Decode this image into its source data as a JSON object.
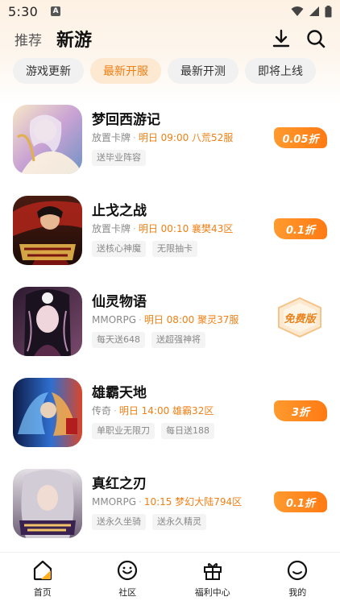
{
  "status_bar": {
    "time": "5:30",
    "notification_letter": "A"
  },
  "header": {
    "tab_recommend": "推荐",
    "tab_new_games": "新游",
    "download_icon": "download-icon",
    "search_icon": "search-icon"
  },
  "filters": [
    {
      "label": "游戏更新",
      "active": false
    },
    {
      "label": "最新开服",
      "active": true
    },
    {
      "label": "最新开测",
      "active": false
    },
    {
      "label": "即将上线",
      "active": false
    }
  ],
  "games": [
    {
      "title": "梦回西游记",
      "type": "放置卡牌",
      "open_info": "明日 09:00 八荒52服",
      "tags": [
        "送毕业阵容"
      ],
      "badge": "0.05折",
      "badge_kind": "discount",
      "cover_colors": [
        "#f3e0c0",
        "#c8a3d8",
        "#7aa0c8"
      ]
    },
    {
      "title": "止戈之战",
      "type": "放置卡牌",
      "open_info": "明日 00:10 襄樊43区",
      "tags": [
        "送核心神魔",
        "无限抽卡"
      ],
      "badge": "0.1折",
      "badge_kind": "discount",
      "cover_colors": [
        "#3a1a14",
        "#b8261c",
        "#e7b64a"
      ]
    },
    {
      "title": "仙灵物语",
      "type": "MMORPG",
      "open_info": "明日 08:00 聚灵37服",
      "tags": [
        "每天送648",
        "送超强神将"
      ],
      "badge": "免费版",
      "badge_kind": "free",
      "cover_colors": [
        "#2b1b2e",
        "#7b4a6e",
        "#e6c9d0"
      ]
    },
    {
      "title": "雄霸天地",
      "type": "传奇",
      "open_info": "明日 14:00 雄霸32区",
      "tags": [
        "单职业无限刀",
        "每日送188"
      ],
      "badge": "3折",
      "badge_kind": "discount",
      "cover_colors": [
        "#0e1e4a",
        "#3a7ed8",
        "#e85a2a"
      ]
    },
    {
      "title": "真红之刃",
      "type": "MMORPG",
      "open_info": "10:15 梦幻大陆794区",
      "tags": [
        "送永久坐骑",
        "送永久精灵"
      ],
      "badge": "0.1折",
      "badge_kind": "discount",
      "cover_colors": [
        "#d8d4d8",
        "#8a7c8e",
        "#3a2e44"
      ]
    }
  ],
  "bottom_nav": [
    {
      "label": "首页",
      "icon": "home-icon"
    },
    {
      "label": "社区",
      "icon": "community-icon"
    },
    {
      "label": "福利中心",
      "icon": "gift-icon"
    },
    {
      "label": "我的",
      "icon": "profile-icon"
    }
  ]
}
